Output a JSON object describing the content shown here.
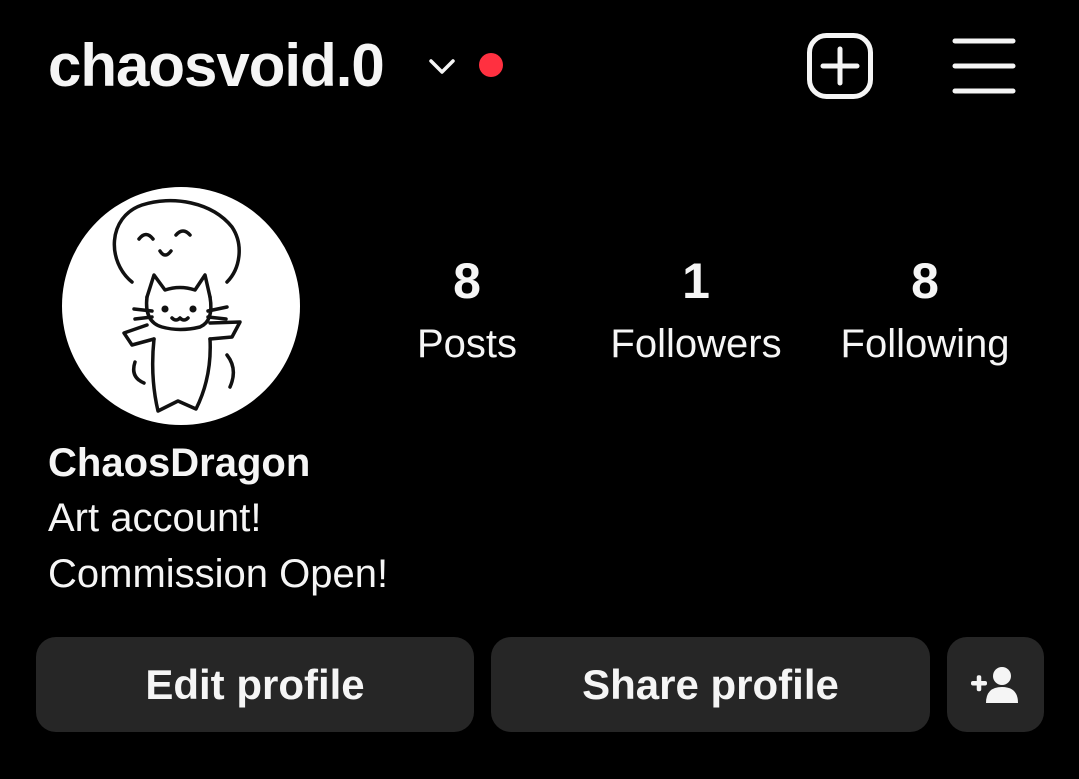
{
  "header": {
    "username": "chaosvoid.0",
    "account_switch_icon": "chevron-down-icon",
    "notification_dot_color": "#ff3040",
    "new_post_icon": "plus-square-icon",
    "menu_icon": "hamburger-menu-icon"
  },
  "profile": {
    "avatar_icon": "cat-doodle-avatar",
    "display_name": "ChaosDragon",
    "bio_lines": [
      "Art account!",
      "Commission Open!"
    ]
  },
  "stats": [
    {
      "count": "8",
      "label": "Posts"
    },
    {
      "count": "1",
      "label": "Followers"
    },
    {
      "count": "8",
      "label": "Following"
    }
  ],
  "actions": {
    "edit_label": "Edit profile",
    "share_label": "Share profile",
    "add_user_icon": "person-add-icon"
  },
  "colors": {
    "background": "#000000",
    "text": "#f5f5f5",
    "button_bg": "#262626"
  }
}
